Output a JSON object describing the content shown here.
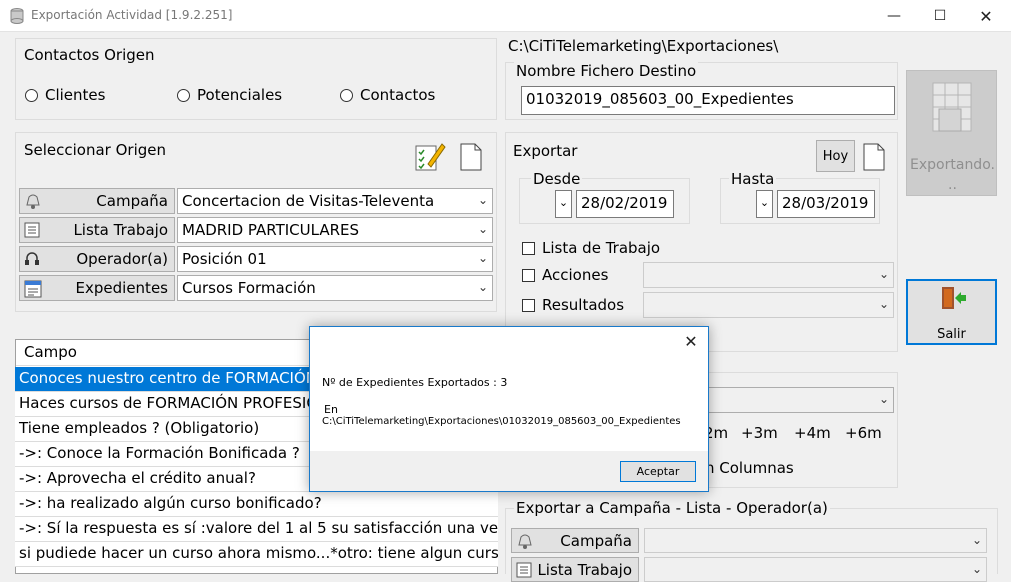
{
  "window": {
    "title": "Exportación Actividad [1.9.2.251]"
  },
  "contactos": {
    "legend": "Contactos Origen",
    "options": [
      "Clientes",
      "Potenciales",
      "Contactos"
    ]
  },
  "path": "C:\\CiTiTelemarketing\\Exportaciones\\",
  "fichero": {
    "legend": "Nombre Fichero Destino",
    "value": "01032019_085603_00_Expedientes"
  },
  "exportando": {
    "label": "Exportando. .."
  },
  "salir": {
    "label": "Salir"
  },
  "seleccionar": {
    "legend": "Seleccionar Origen",
    "rows": [
      {
        "label": "Campaña",
        "value": "Concertacion de Visitas-Televenta"
      },
      {
        "label": "Lista Trabajo",
        "value": "MADRID PARTICULARES"
      },
      {
        "label": "Operador(a)",
        "value": "Posición 01"
      },
      {
        "label": "Expedientes",
        "value": "Cursos Formación"
      }
    ]
  },
  "exportar": {
    "legend": "Exportar",
    "hoy": "Hoy",
    "desde_label": "Desde",
    "desde": "28/02/2019",
    "hasta_label": "Hasta",
    "hasta": "28/03/2019",
    "checks": [
      "Lista de Trabajo",
      "Acciones",
      "Resultados"
    ]
  },
  "opciones": {
    "months": [
      "2m",
      "+3m",
      "+4m",
      "+6m"
    ],
    "columnas": "n Columnas"
  },
  "grid": {
    "header": "Campo",
    "rows": [
      "Conoces nuestro centro  de FORMACIÓN",
      "Haces cursos de FORMACIÓN PROFESION",
      "Tiene empleados ? (Obligatorio)",
      "->: Conoce la Formación Bonificada ?",
      "->: Aprovecha el crédito anual?",
      "->: ha realizado algún curso bonificado?",
      "->:  Sí la respuesta es sí :valore del 1 al 5 su satisfacción una vez finali",
      "si pudiede hacer un curso ahora mismo...*otro: tiene algun curso pens"
    ]
  },
  "exportar_a": {
    "legend": "Exportar a  Campaña - Lista - Operador(a)",
    "rows": [
      "Campaña",
      "Lista Trabajo"
    ]
  },
  "dialog": {
    "line1": "Nº de Expedientes Exportados : 3",
    "line2": "En",
    "line3": "C:\\CiTiTelemarketing\\Exportaciones\\01032019_085603_00_Expedientes",
    "accept": "Aceptar"
  }
}
